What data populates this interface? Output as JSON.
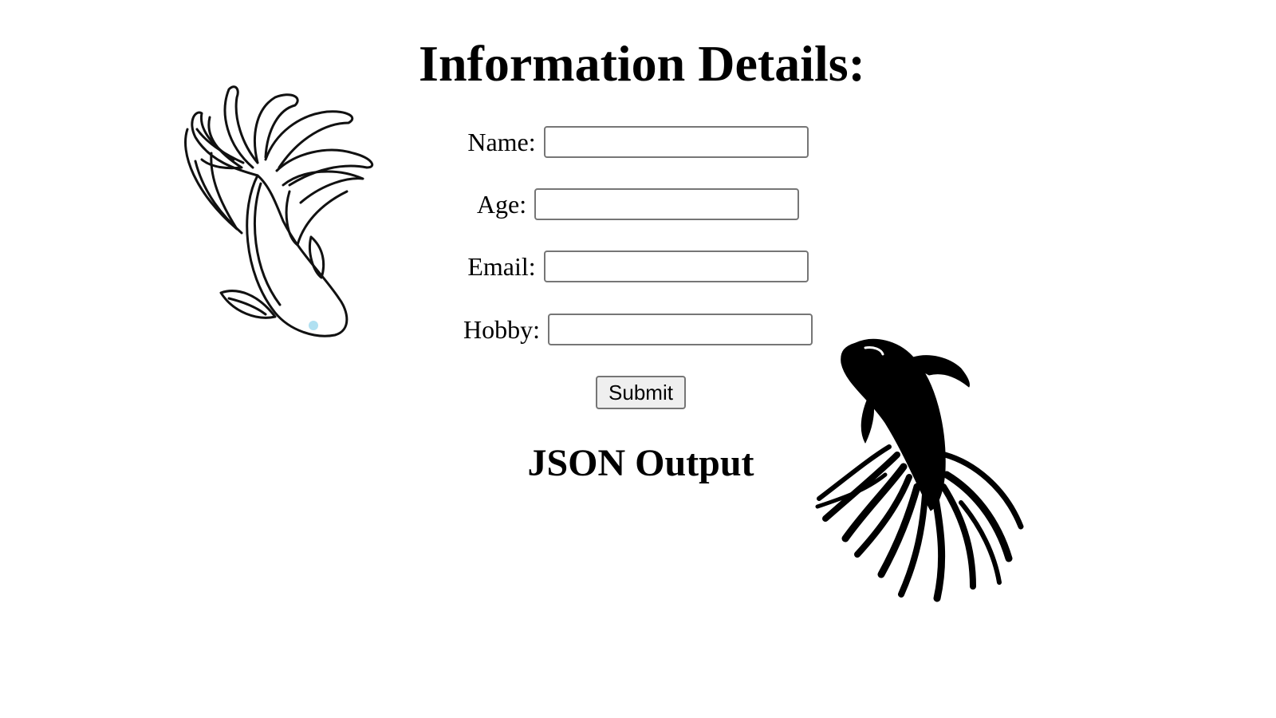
{
  "page": {
    "title": "Information Details:",
    "output_heading": "JSON Output"
  },
  "form": {
    "name_label": "Name:",
    "name_value": "",
    "age_label": "Age:",
    "age_value": "",
    "email_label": "Email:",
    "email_value": "",
    "hobby_label": "Hobby:",
    "hobby_value": "",
    "submit_label": "Submit"
  },
  "decorations": {
    "left_image": "koi-fish-outline-icon",
    "right_image": "koi-fish-silhouette-icon"
  }
}
